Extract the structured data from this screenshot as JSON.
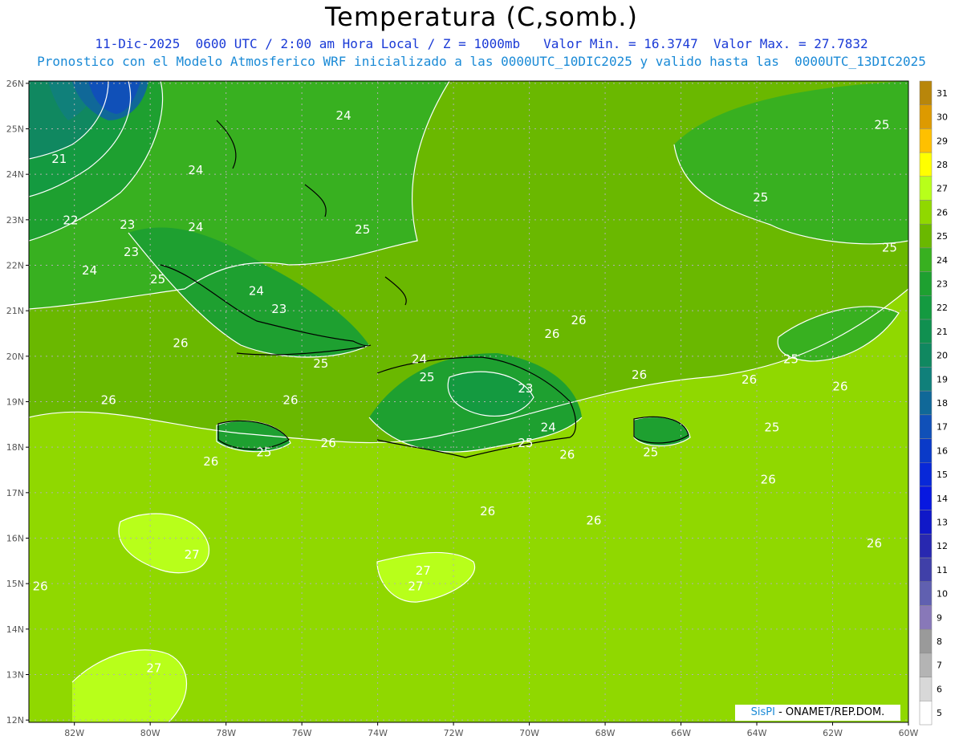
{
  "title": "Temperatura (C,somb.)",
  "subtitle_line1": "11-Dic-2025  0600 UTC / 2:00 am Hora Local / Z = 1000mb   Valor Min. = 16.3747  Valor Max. = 27.7832",
  "subtitle_line2": "Pronostico con el Modelo Atmosferico WRF inicializado a las 0000UTC_10DIC2025 y valido hasta las  0000UTC_13DIC2025",
  "lat_labels": [
    "26N",
    "25N",
    "24N",
    "23N",
    "22N",
    "21N",
    "20N",
    "19N",
    "18N",
    "17N",
    "16N",
    "15N",
    "14N",
    "13N",
    "12N"
  ],
  "lon_labels": [
    "82W",
    "80W",
    "78W",
    "76W",
    "74W",
    "72W",
    "70W",
    "68W",
    "66W",
    "64W",
    "62W",
    "60W"
  ],
  "colorbar": {
    "levels": [
      "31",
      "30",
      "29",
      "28",
      "27",
      "26",
      "25",
      "24",
      "23",
      "22",
      "21",
      "20",
      "19",
      "18",
      "17",
      "16",
      "15",
      "14",
      "13",
      "12",
      "11",
      "10",
      "9",
      "8",
      "7",
      "6",
      "5"
    ],
    "colors": [
      "#b8860b",
      "#dd9a00",
      "#ffc000",
      "#ffff00",
      "#b8ff1a",
      "#90d800",
      "#6ab800",
      "#38b020",
      "#1ea030",
      "#149a40",
      "#109050",
      "#108860",
      "#10807a",
      "#106898",
      "#1050b8",
      "#0a3ac8",
      "#0828d8",
      "#0818e0",
      "#1018c8",
      "#2828b0",
      "#4040a8",
      "#6060b0",
      "#8878b8",
      "#9a9a9a",
      "#b4b4b4",
      "#d8d8d8",
      "#ffffff"
    ]
  },
  "contour_labels": [
    {
      "text": "21",
      "lon": -82.4,
      "lat": 24.25
    },
    {
      "text": "22",
      "lon": -82.1,
      "lat": 22.9
    },
    {
      "text": "23",
      "lon": -80.6,
      "lat": 22.8
    },
    {
      "text": "23",
      "lon": -80.5,
      "lat": 22.2
    },
    {
      "text": "24",
      "lon": -78.8,
      "lat": 24.0
    },
    {
      "text": "24",
      "lon": -78.8,
      "lat": 22.75
    },
    {
      "text": "24",
      "lon": -81.6,
      "lat": 21.8
    },
    {
      "text": "24",
      "lon": -74.9,
      "lat": 25.2
    },
    {
      "text": "25",
      "lon": -79.8,
      "lat": 21.6
    },
    {
      "text": "24",
      "lon": -77.2,
      "lat": 21.35
    },
    {
      "text": "23",
      "lon": -76.6,
      "lat": 20.95
    },
    {
      "text": "25",
      "lon": -74.4,
      "lat": 22.7
    },
    {
      "text": "26",
      "lon": -79.2,
      "lat": 20.2
    },
    {
      "text": "25",
      "lon": -75.5,
      "lat": 19.75
    },
    {
      "text": "26",
      "lon": -81.1,
      "lat": 18.95
    },
    {
      "text": "26",
      "lon": -76.3,
      "lat": 18.95
    },
    {
      "text": "26",
      "lon": -75.3,
      "lat": 18.0
    },
    {
      "text": "25",
      "lon": -77.0,
      "lat": 17.8
    },
    {
      "text": "26",
      "lon": -78.4,
      "lat": 17.6
    },
    {
      "text": "24",
      "lon": -72.9,
      "lat": 19.85
    },
    {
      "text": "25",
      "lon": -72.7,
      "lat": 19.45
    },
    {
      "text": "23",
      "lon": -70.1,
      "lat": 19.2
    },
    {
      "text": "24",
      "lon": -69.5,
      "lat": 18.35
    },
    {
      "text": "25",
      "lon": -70.1,
      "lat": 18.0
    },
    {
      "text": "26",
      "lon": -69.4,
      "lat": 20.4
    },
    {
      "text": "26",
      "lon": -68.7,
      "lat": 20.7
    },
    {
      "text": "26",
      "lon": -67.1,
      "lat": 19.5
    },
    {
      "text": "26",
      "lon": -69.0,
      "lat": 17.75
    },
    {
      "text": "25",
      "lon": -66.8,
      "lat": 17.8
    },
    {
      "text": "26",
      "lon": -71.1,
      "lat": 16.5
    },
    {
      "text": "26",
      "lon": -68.3,
      "lat": 16.3
    },
    {
      "text": "27",
      "lon": -78.9,
      "lat": 15.55
    },
    {
      "text": "27",
      "lon": -72.8,
      "lat": 15.2
    },
    {
      "text": "27",
      "lon": -73.0,
      "lat": 14.85
    },
    {
      "text": "27",
      "lon": -79.9,
      "lat": 13.05
    },
    {
      "text": "26",
      "lon": -82.9,
      "lat": 14.85
    },
    {
      "text": "25",
      "lon": -60.7,
      "lat": 25.0
    },
    {
      "text": "25",
      "lon": -63.9,
      "lat": 23.4
    },
    {
      "text": "25",
      "lon": -60.5,
      "lat": 22.3
    },
    {
      "text": "25",
      "lon": -63.1,
      "lat": 19.85
    },
    {
      "text": "26",
      "lon": -64.2,
      "lat": 19.4
    },
    {
      "text": "26",
      "lon": -61.8,
      "lat": 19.25
    },
    {
      "text": "25",
      "lon": -63.6,
      "lat": 18.35
    },
    {
      "text": "26",
      "lon": -63.7,
      "lat": 17.2
    },
    {
      "text": "26",
      "lon": -60.9,
      "lat": 15.8
    }
  ],
  "credit_brand": "SisPI",
  "credit_org": "- ONAMET/REP.DOM."
}
